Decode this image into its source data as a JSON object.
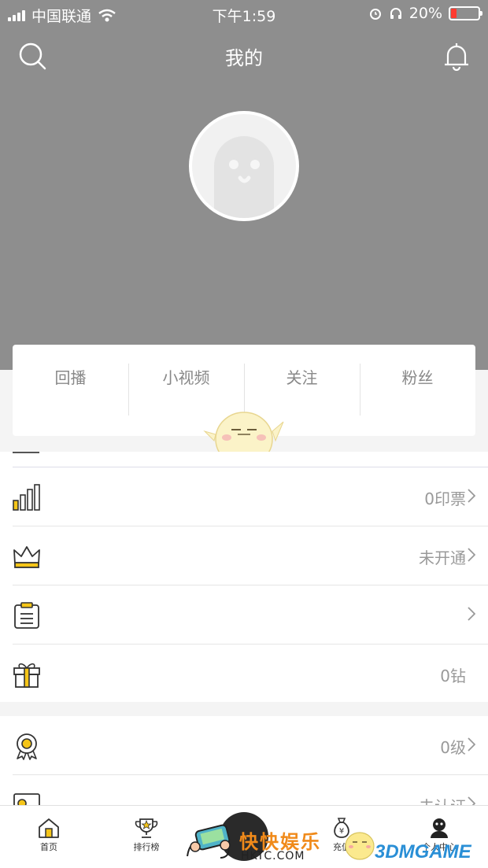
{
  "status_bar": {
    "carrier": "中国联通",
    "time": "下午1:59",
    "battery": "20%",
    "battery_level": 0.2,
    "colors": {
      "battery_low": "#ff3b30"
    }
  },
  "nav": {
    "title": "我的",
    "left_icon": "search-icon",
    "right_icon": "bell-icon"
  },
  "stats": {
    "items": [
      {
        "label": "回播"
      },
      {
        "label": "小视频"
      },
      {
        "label": "关注"
      },
      {
        "label": "粉丝"
      }
    ]
  },
  "list_1": {
    "rows": [
      {
        "icon": "bar-chart-icon",
        "value": "0印票",
        "arrow": true
      },
      {
        "icon": "crown-icon",
        "value": "未开通",
        "arrow": true
      },
      {
        "icon": "clipboard-icon",
        "value": "",
        "arrow": true
      },
      {
        "icon": "gift-icon",
        "value": "0钻",
        "arrow": false
      }
    ]
  },
  "list_2": {
    "rows": [
      {
        "icon": "medal-icon",
        "value": "0级",
        "arrow": true
      },
      {
        "icon": "id-card-icon",
        "value": "未认证",
        "arrow": true
      }
    ]
  },
  "tabbar": {
    "items": [
      {
        "label": "首页",
        "icon": "home-icon"
      },
      {
        "label": "排行榜",
        "icon": "trophy-icon"
      },
      {
        "label": "充值",
        "icon": "money-bag-icon"
      },
      {
        "label": "个人中心",
        "icon": "user-icon"
      }
    ]
  },
  "watermarks": {
    "site_cn": "快快娱乐",
    "site_url": "HKTC.COM",
    "brand": "3DMGAME"
  },
  "colors": {
    "header_bg": "#8e8e8e",
    "accent_yellow": "#f5c518",
    "page_bg": "#f4f4f4"
  }
}
